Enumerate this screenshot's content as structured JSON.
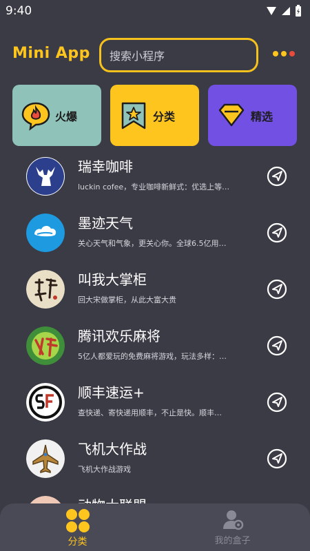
{
  "status_bar": {
    "time": "9:40"
  },
  "header": {
    "title": "Mini App",
    "search_placeholder": "搜索小程序"
  },
  "categories": [
    {
      "label": "火爆",
      "bg": "#8fc3b9",
      "icon": "fire-chat-icon"
    },
    {
      "label": "分类",
      "bg": "#ffc51f",
      "icon": "star-bookmark-icon"
    },
    {
      "label": "精选",
      "bg": "#7150e3",
      "icon": "gem-icon"
    }
  ],
  "apps": [
    {
      "name": "瑞幸咖啡",
      "desc": "luckin cofee，专业咖啡新鲜式：优选上等…",
      "icon": "luckin-deer-icon"
    },
    {
      "name": "墨迹天气",
      "desc": "关心天气和气象，更关心你。全球6.5亿用…",
      "icon": "moji-cloud-icon"
    },
    {
      "name": "叫我大掌柜",
      "desc": "回大宋做掌柜，从此大富大贵",
      "icon": "zhanggui-calligraphy-icon"
    },
    {
      "name": "腾讯欢乐麻将",
      "desc": "5亿人都爱玩的免费麻将游戏，玩法多样：…",
      "icon": "mahjong-icon"
    },
    {
      "name": "顺丰速运+",
      "desc": "查快递、寄快递用顺丰，不止是快。顺丰…",
      "icon": "sf-express-icon"
    },
    {
      "name": "飞机大作战",
      "desc": "飞机大作战游戏",
      "icon": "plane-icon"
    },
    {
      "name": "动物大联盟",
      "desc": "",
      "icon": "animal-icon"
    }
  ],
  "bottom_nav": [
    {
      "label": "分类",
      "active": true
    },
    {
      "label": "我的盒子",
      "active": false
    }
  ],
  "colors": {
    "accent": "#ffc51f",
    "background": "#3b3b46",
    "nav_bg": "#4a4a56"
  }
}
